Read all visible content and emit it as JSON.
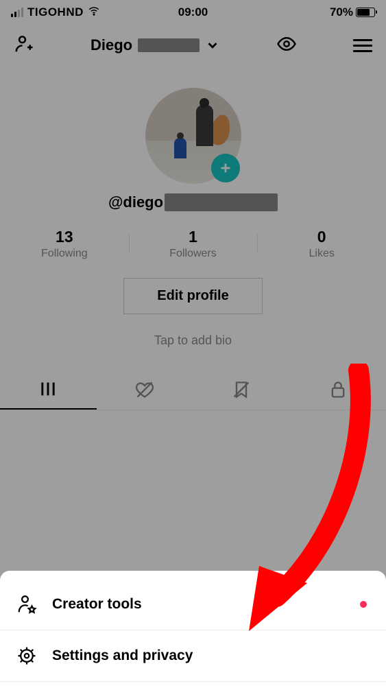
{
  "status_bar": {
    "carrier": "TIGOHND",
    "time": "09:00",
    "battery_percent": "70%"
  },
  "header": {
    "display_name_prefix": "Diego"
  },
  "profile": {
    "username_prefix": "@diego",
    "stats": {
      "following": {
        "value": "13",
        "label": "Following"
      },
      "followers": {
        "value": "1",
        "label": "Followers"
      },
      "likes": {
        "value": "0",
        "label": "Likes"
      }
    },
    "edit_button_label": "Edit profile",
    "bio_placeholder": "Tap to add bio"
  },
  "sheet": {
    "items": [
      {
        "label": "Creator tools"
      },
      {
        "label": "Settings and privacy"
      }
    ]
  }
}
